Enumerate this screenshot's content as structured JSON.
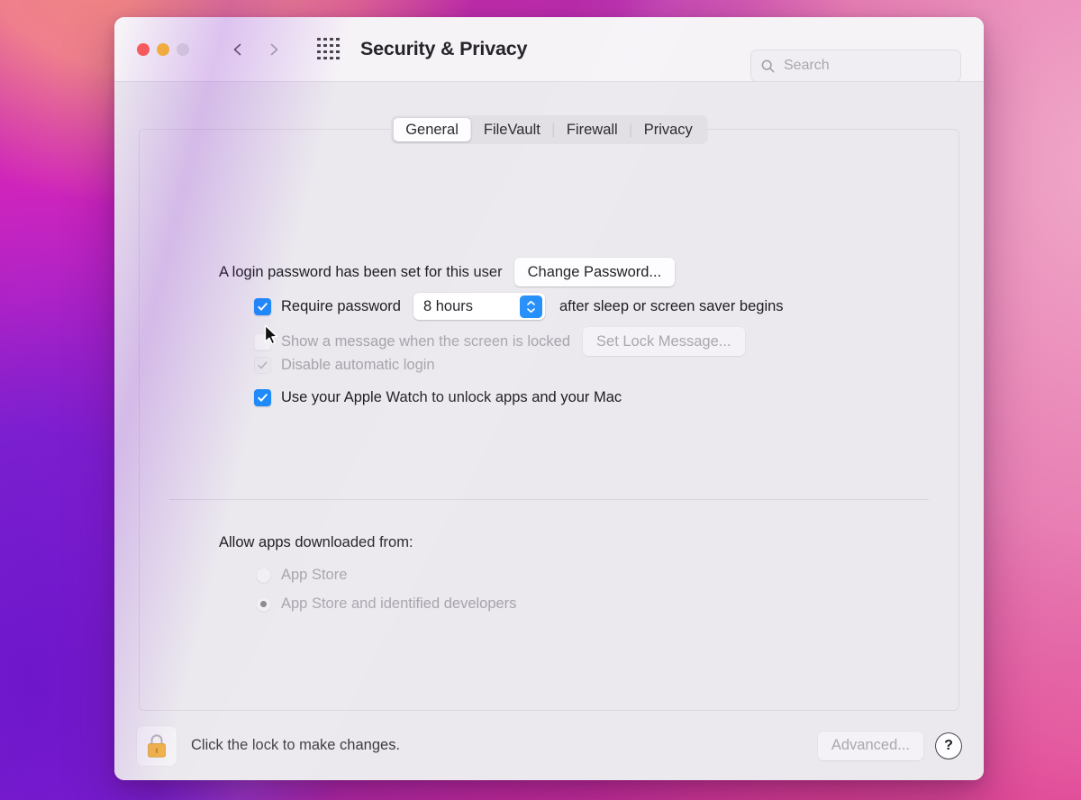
{
  "window": {
    "title": "Security & Privacy",
    "traffic_lights": [
      "close",
      "minimize",
      "zoom"
    ],
    "nav": {
      "back": "back-chevron",
      "forward": "forward-chevron"
    },
    "grid_icon": "show-all-grid-icon"
  },
  "search": {
    "placeholder": "Search",
    "value": "",
    "icon": "search-icon"
  },
  "tabs": [
    {
      "label": "General",
      "active": true
    },
    {
      "label": "FileVault",
      "active": false
    },
    {
      "label": "Firewall",
      "active": false
    },
    {
      "label": "Privacy",
      "active": false
    }
  ],
  "general": {
    "password_status": "A login password has been set for this user",
    "change_password_label": "Change Password...",
    "require_password": {
      "label": "Require password",
      "checked": true,
      "enabled": true,
      "delay_value": "8 hours",
      "suffix": "after sleep or screen saver begins"
    },
    "show_message": {
      "label": "Show a message when the screen is locked",
      "checked": false,
      "enabled": false,
      "button_label": "Set Lock Message..."
    },
    "disable_auto_login": {
      "label": "Disable automatic login",
      "checked": true,
      "enabled": false
    },
    "apple_watch": {
      "label": "Use your Apple Watch to unlock apps and your Mac",
      "checked": true,
      "enabled": true,
      "focused": true
    },
    "allow_apps": {
      "title": "Allow apps downloaded from:",
      "options": [
        {
          "label": "App Store",
          "selected": false
        },
        {
          "label": "App Store and identified developers",
          "selected": true
        }
      ],
      "enabled": false
    }
  },
  "footer": {
    "lock_icon": "lock-closed-icon",
    "lock_text": "Click the lock to make changes.",
    "advanced_label": "Advanced...",
    "advanced_enabled": false,
    "help_label": "?"
  },
  "colors": {
    "accent_blue": "#1e8bfa",
    "window_bg": "#ebe9ee",
    "titlebar_bg": "#f6f3f7",
    "lock_body": "#f0b44a",
    "traffic_close": "#fc5f57",
    "traffic_min": "#fcbd2e",
    "traffic_zoom": "#dedede"
  }
}
